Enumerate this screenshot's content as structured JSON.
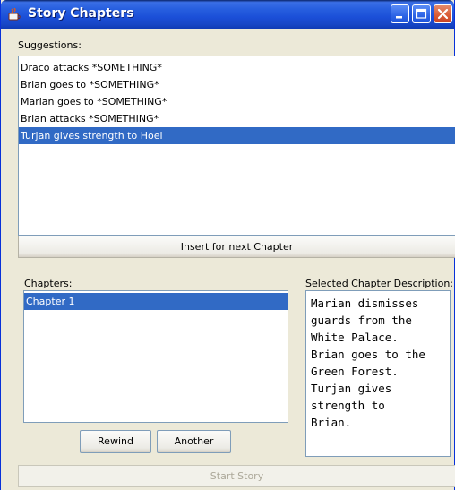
{
  "window": {
    "title": "Story Chapters",
    "icons": {
      "app": "java-cup-icon",
      "minimize": "minimize-icon",
      "maximize": "maximize-icon",
      "close": "close-icon"
    }
  },
  "suggestions": {
    "label": "Suggestions:",
    "items": [
      "Draco attacks *SOMETHING*",
      "Brian goes to *SOMETHING*",
      "Marian goes to *SOMETHING*",
      "Brian attacks *SOMETHING*",
      "Turjan gives strength to Hoel"
    ],
    "selected_index": 4,
    "insert_button": "Insert for next Chapter"
  },
  "chapters": {
    "label": "Chapters:",
    "items": [
      "Chapter 1"
    ],
    "selected_index": 0,
    "rewind_button": "Rewind",
    "another_button": "Another"
  },
  "description": {
    "label": "Selected Chapter Description:",
    "lines": [
      "Marian dismisses",
      "guards from the",
      "White Palace.",
      "Brian goes to the",
      "Green Forest.",
      "Turjan gives",
      "strength to",
      "Brian."
    ]
  },
  "start_button": "Start Story",
  "colors": {
    "selection": "#316ac5",
    "title_bar": "#2860df",
    "window_bg": "#ece9d8"
  }
}
